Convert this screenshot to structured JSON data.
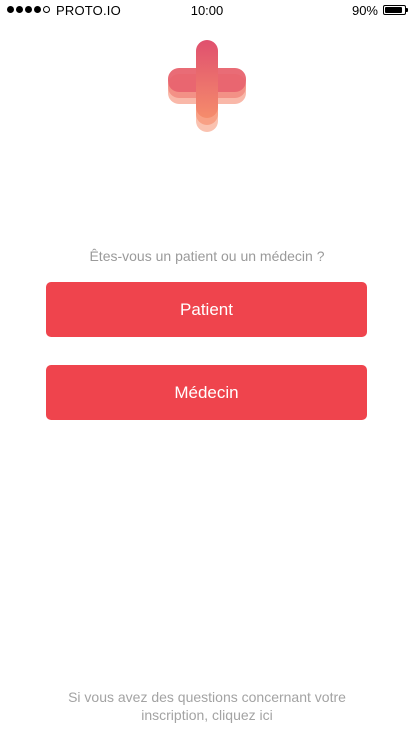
{
  "status_bar": {
    "carrier": "PROTO.IO",
    "time": "10:00",
    "battery": "90%",
    "battery_level": 0.9,
    "signal_bars_filled": 4,
    "signal_bars_total": 5
  },
  "logo": {
    "icon": "medical-cross-icon",
    "colors": [
      "#e0506e",
      "#f07a6a",
      "#f8a992"
    ]
  },
  "question": "Êtes-vous un patient ou un médecin ?",
  "buttons": {
    "patient_label": "Patient",
    "medecin_label": "Médecin",
    "color": "#ef444d"
  },
  "footer": {
    "line1": "Si vous avez des questions concernant votre",
    "line2": "inscription, cliquez ici"
  }
}
